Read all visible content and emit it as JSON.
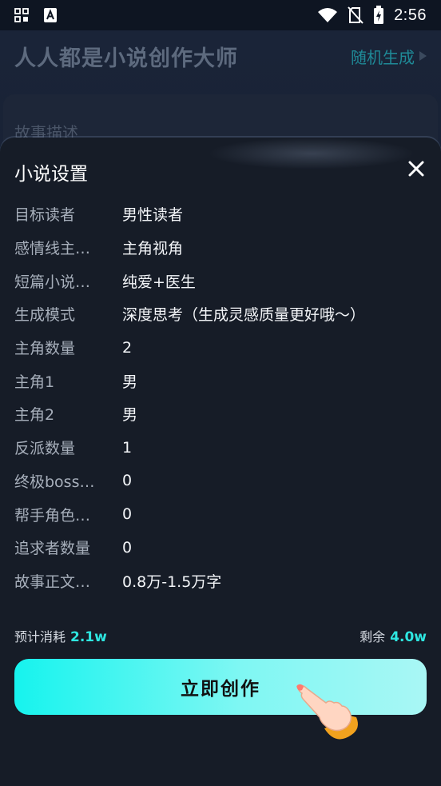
{
  "status_bar": {
    "time": "2:56",
    "icons": [
      "grid-icon",
      "keyboard-a-icon",
      "wifi-icon",
      "no-sim-icon",
      "battery-charging-icon"
    ]
  },
  "header": {
    "title": "人人都是小说创作大师",
    "random_label": "随机生成"
  },
  "background": {
    "card_label": "故事描述"
  },
  "sheet": {
    "title": "小说设置",
    "settings": [
      {
        "label": "目标读者",
        "value": "男性读者"
      },
      {
        "label": "感情线主…",
        "value": "主角视角"
      },
      {
        "label": "短篇小说…",
        "value": "纯爱+医生"
      },
      {
        "label": "生成模式",
        "value": "深度思考（生成灵感质量更好哦～）"
      },
      {
        "label": "主角数量",
        "value": "2"
      },
      {
        "label": "主角1",
        "value": "男"
      },
      {
        "label": "主角2",
        "value": "男"
      },
      {
        "label": "反派数量",
        "value": "1"
      },
      {
        "label": "终极boss…",
        "value": "0"
      },
      {
        "label": "帮手角色…",
        "value": "0"
      },
      {
        "label": "追求者数量",
        "value": "0"
      },
      {
        "label": "故事正文…",
        "value": "0.8万-1.5万字"
      }
    ],
    "cost_label": "预计消耗",
    "cost_value": "2.1w",
    "remain_label": "剩余",
    "remain_value": "4.0w",
    "create_label": "立即创作"
  },
  "colors": {
    "accent": "#2ee6e0",
    "sheet_bg": "#161c27",
    "button_gradient_start": "#16f3ee",
    "button_gradient_end": "#a9f7f5"
  }
}
